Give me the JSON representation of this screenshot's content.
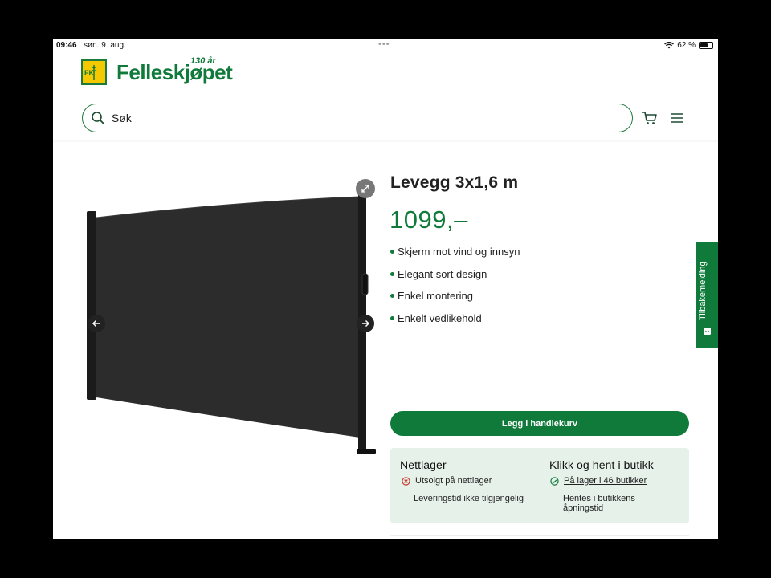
{
  "status_bar": {
    "time": "09:46",
    "date": "søn. 9. aug.",
    "battery": "62 %",
    "battery_level": 0.62
  },
  "header": {
    "logo_text": "Felleskjøpet",
    "logo_badge": "FK",
    "anniversary": "130 år",
    "search_placeholder": "Søk"
  },
  "product": {
    "title": "Levegg 3x1,6 m",
    "price": "1099,–",
    "features": [
      "Skjerm mot vind og innsyn",
      "Elegant sort design",
      "Enkel montering",
      "Enkelt vedlikehold"
    ],
    "add_to_cart_label": "Legg i handlekurv"
  },
  "availability": {
    "online": {
      "title": "Nettlager",
      "status": "Utsolgt på nettlager",
      "note": "Leveringstid ikke tilgjengelig"
    },
    "store": {
      "title": "Klikk og hent i butikk",
      "status": "På lager i 46 butikker",
      "note_line1": "Hentes i butikkens",
      "note_line2": "åpningstid"
    }
  },
  "feedback_tab_label": "Tilbakemelding",
  "colors": {
    "brand_green": "#0f7a3a",
    "logo_yellow": "#f5c800",
    "stock_bg": "#e6f1ea",
    "error_red": "#c0392b"
  }
}
